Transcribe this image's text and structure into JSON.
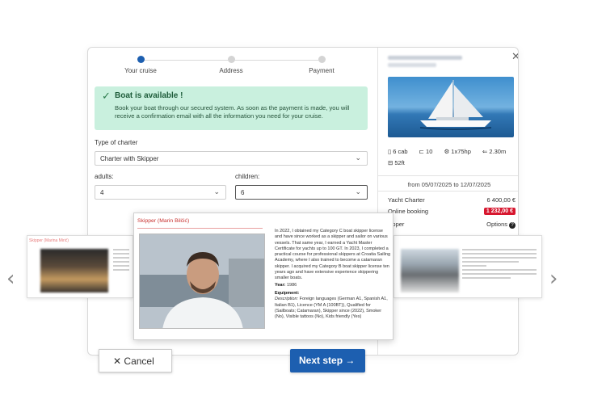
{
  "stepper": {
    "steps": [
      "Your cruise",
      "Address",
      "Payment"
    ]
  },
  "availability": {
    "title": "Boat is available !",
    "text": "Book your boat through our secured system. As soon as the payment is made, you will receive a confirmation email with all the information you need for your cruise."
  },
  "form": {
    "charter_label": "Type of charter",
    "charter_value": "Charter with Skipper",
    "adults_label": "adults:",
    "adults_value": "4",
    "children_label": "children:",
    "children_value": "6"
  },
  "boat": {
    "specs": [
      "6 cab",
      "10",
      "1x75hp",
      "2.30m",
      "52ft"
    ],
    "dates": "from 05/07/2025 to 12/07/2025",
    "prices": [
      {
        "label": "Yacht Charter",
        "value": "6 400,00 €"
      },
      {
        "label": "Online booking",
        "value": "1 232,00 €"
      },
      {
        "label": "kipper",
        "value": "Options"
      }
    ]
  },
  "skipper": {
    "title": "Skipper (Marin Bilčić)",
    "bio": "In 2022, I obtained my Category C boat skipper license and have since worked as a skipper and sailor on various vessels. That same year, I earned a Yacht Master Certificate for yachts up to 100 GT. In 2023, I completed a practical course for professional skippers at Croatia Sailing Academy, where I also trained to become a catamaran skipper. I acquired my Category B boat skipper license ten years ago and have extensive experience skippering smaller boats.",
    "year_label": "Year:",
    "year_value": "1986",
    "equipment_label": "Equipment:",
    "description_label": "Description:",
    "description_value": "Foreign languages (German A1, Spanish A1, Italian B1), Licence (YM A (100BT)), Qualified for (Sailboats; Catamaran), Skipper since (2022), Smoker (No), Visible tattoos (No), Kids friendly (Yes)"
  },
  "side_cards": {
    "left_header": "Skipper (Marina Mirić)"
  },
  "buttons": {
    "cancel": "Cancel",
    "next": "Next step"
  },
  "icons": {
    "close": "close-icon",
    "check": "check-icon",
    "prev": "chevron-left-icon",
    "next": "chevron-right-icon"
  },
  "colors": {
    "accent": "#1d5fb0",
    "success_bg": "#c9f0de",
    "badge": "#d7172f"
  }
}
